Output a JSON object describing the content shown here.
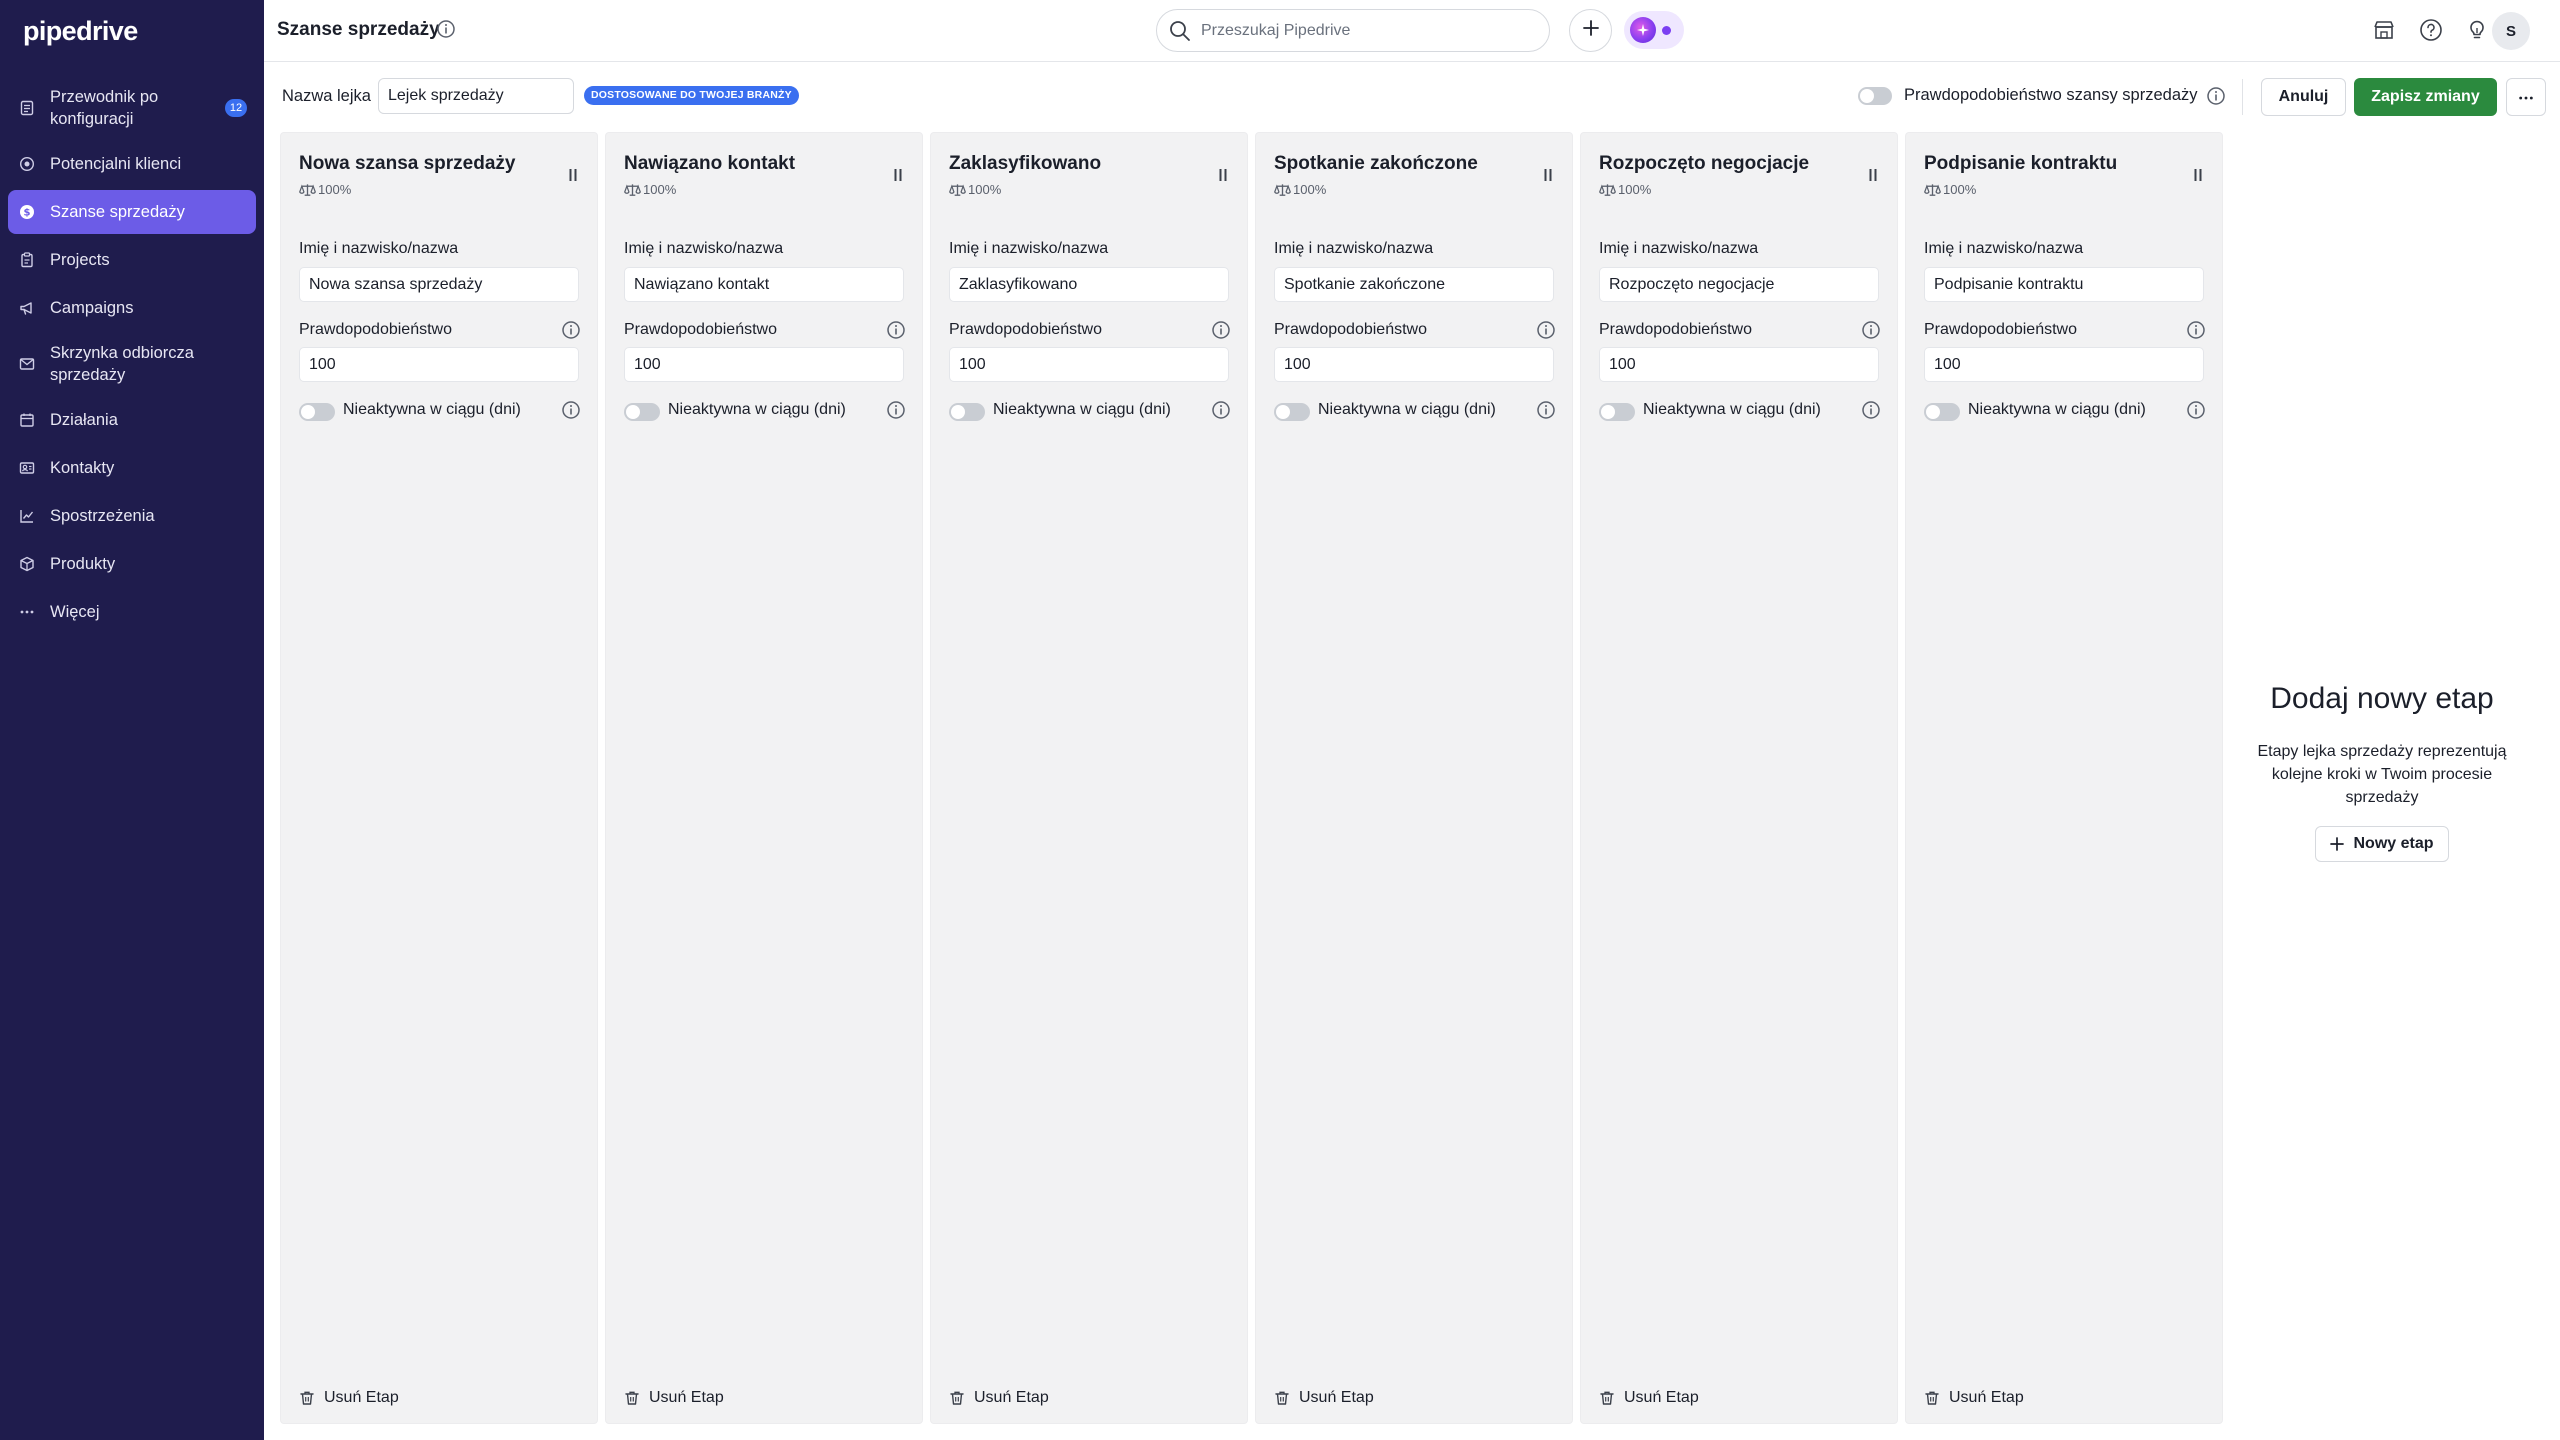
{
  "app": {
    "logo": "pipedrive"
  },
  "header": {
    "title": "Szanse sprzedaży",
    "search_placeholder": "Przeszukaj Pipedrive",
    "avatar_initial": "S"
  },
  "sidebar": {
    "items": [
      {
        "label": "Przewodnik po konfiguracji",
        "icon": "checklist-icon",
        "badge": "12"
      },
      {
        "label": "Potencjalni klienci",
        "icon": "target-icon"
      },
      {
        "label": "Szanse sprzedaży",
        "icon": "dollar-icon",
        "active": true
      },
      {
        "label": "Projects",
        "icon": "clipboard-icon"
      },
      {
        "label": "Campaigns",
        "icon": "megaphone-icon"
      },
      {
        "label": "Skrzynka odbiorcza sprzedaży",
        "icon": "inbox-icon"
      },
      {
        "label": "Działania",
        "icon": "calendar-icon"
      },
      {
        "label": "Kontakty",
        "icon": "contacts-icon"
      },
      {
        "label": "Spostrzeżenia",
        "icon": "chart-icon"
      },
      {
        "label": "Produkty",
        "icon": "box-icon"
      },
      {
        "label": "Więcej",
        "icon": "more-icon"
      }
    ]
  },
  "toolbar": {
    "pipeline_label": "Nazwa lejka",
    "pipeline_name": "Lejek sprzedaży",
    "industry_badge": "DOSTOSOWANE DO TWOJEJ BRANŻY",
    "probability_toggle_label": "Prawdopodobieństwo szansy sprzedaży",
    "cancel_label": "Anuluj",
    "save_label": "Zapisz zmiany"
  },
  "stage_labels": {
    "name_label": "Imię i nazwisko/nazwa",
    "probability_label": "Prawdopodobieństwo",
    "inactive_label": "Nieaktywna w ciągu (dni)",
    "delete_label": "Usuń Etap"
  },
  "stages": [
    {
      "name": "Nowa szansa sprzedaży",
      "probability_display": "100%",
      "name_value": "Nowa szansa sprzedaży",
      "probability_value": "100"
    },
    {
      "name": "Nawiązano kontakt",
      "probability_display": "100%",
      "name_value": "Nawiązano kontakt",
      "probability_value": "100"
    },
    {
      "name": "Zaklasyfikowano",
      "probability_display": "100%",
      "name_value": "Zaklasyfikowano",
      "probability_value": "100"
    },
    {
      "name": "Spotkanie zakończone",
      "probability_display": "100%",
      "name_value": "Spotkanie zakończone",
      "probability_value": "100"
    },
    {
      "name": "Rozpoczęto negocjacje",
      "probability_display": "100%",
      "name_value": "Rozpoczęto negocjacje",
      "probability_value": "100"
    },
    {
      "name": "Podpisanie kontraktu",
      "probability_display": "100%",
      "name_value": "Podpisanie kontraktu",
      "probability_value": "100"
    }
  ],
  "add_stage": {
    "title": "Dodaj nowy etap",
    "description": "Etapy lejka sprzedaży reprezentują kolejne kroki w Twoim procesie sprzedaży",
    "button_label": "Nowy etap"
  },
  "colors": {
    "sidebar_bg": "#1f1c4d",
    "active_item": "#6c5ce7",
    "save_button": "#2b8a3e",
    "badge_blue": "#3a6ff0"
  }
}
